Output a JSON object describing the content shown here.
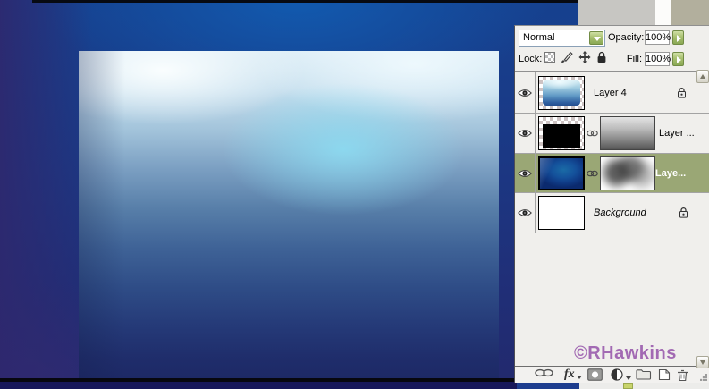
{
  "layers_panel": {
    "blend_mode": {
      "value": "Normal"
    },
    "opacity": {
      "label": "Opacity:",
      "value": "100%"
    },
    "lock_row": {
      "label": "Lock:"
    },
    "fill": {
      "label": "Fill:",
      "value": "100%"
    },
    "layers": [
      {
        "name": "Layer 4",
        "visible": true,
        "locked": true,
        "selected": false,
        "has_mask": false
      },
      {
        "name": "Layer ...",
        "visible": true,
        "locked": false,
        "selected": false,
        "has_mask": true,
        "mask_linked": true
      },
      {
        "name": "Laye...",
        "visible": true,
        "locked": false,
        "selected": true,
        "has_mask": true,
        "mask_linked": true
      },
      {
        "name": "Background",
        "visible": true,
        "locked": true,
        "selected": false,
        "has_mask": false,
        "italic": true
      }
    ],
    "toolbar": {
      "fx_label": "fx",
      "icons": [
        "link-layers",
        "layer-style",
        "add-layer-mask",
        "new-adjustment-layer",
        "new-group",
        "new-layer",
        "delete-layer"
      ]
    },
    "icon_names": [
      "eye-icon",
      "checkerboard-lock-icon",
      "brush-lock-icon",
      "move-lock-icon",
      "padlock-icon",
      "chain-link-icon",
      "dropdown-arrow-icon",
      "spinner-arrow-icon",
      "scroll-up-icon",
      "scroll-down-icon"
    ]
  },
  "watermark": {
    "text": "©RHawkins",
    "color": "#a26ab3"
  },
  "colors": {
    "selected_layer_bg": "#9aa775",
    "accent_green_button": "#a8c070",
    "panel_bg": "#f0efec",
    "palette_well_beige": "#b2af9d",
    "canvas_top": "#dcedf6",
    "canvas_bottom": "#1d2966",
    "background_blue": "#1b3884",
    "bottom_taskbar_blue": "#1e3d8e"
  }
}
